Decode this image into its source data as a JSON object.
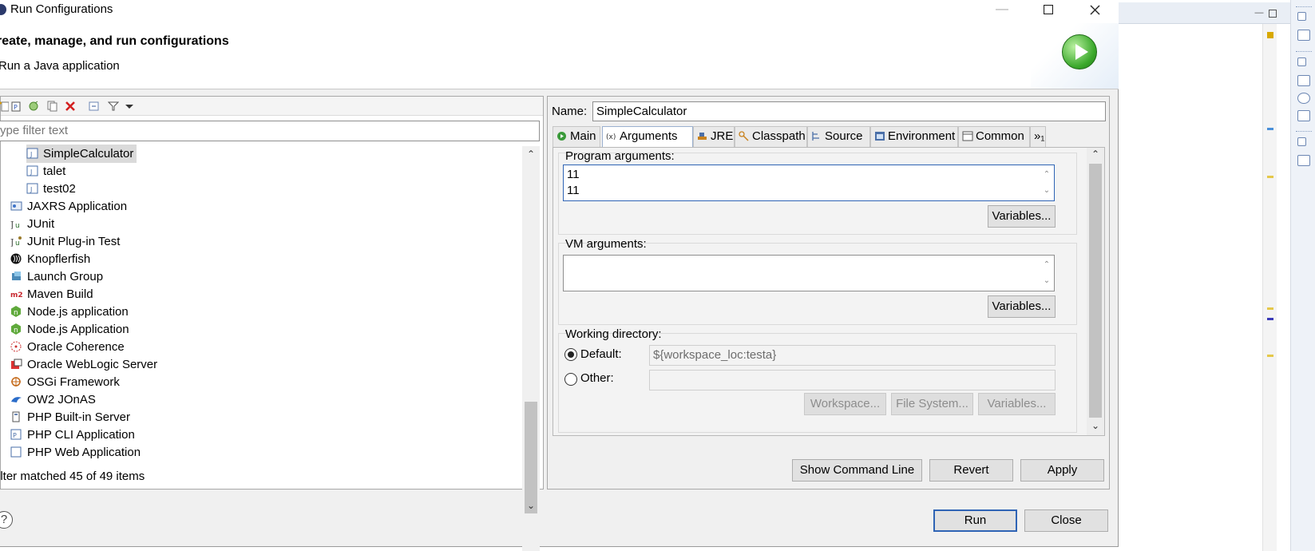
{
  "window": {
    "title": "Run Configurations",
    "minimize_icon": "minimize-icon",
    "maximize_icon": "maximize-icon",
    "close_icon": "close-icon"
  },
  "header": {
    "title": "reate, manage, and run configurations",
    "subtitle": "Run a Java application"
  },
  "left": {
    "filter_placeholder": "ype filter text",
    "status": "ilter matched 45 of 49 items",
    "tree": [
      {
        "label": "SimpleCalculator",
        "icon": "java-app-icon",
        "indent": 1,
        "selected": true
      },
      {
        "label": "talet",
        "icon": "java-app-icon",
        "indent": 1
      },
      {
        "label": "test02",
        "icon": "java-app-icon",
        "indent": 1
      },
      {
        "label": "JAXRS Application",
        "icon": "jaxrs-icon",
        "indent": 0
      },
      {
        "label": "JUnit",
        "icon": "junit-icon",
        "indent": 0
      },
      {
        "label": "JUnit Plug-in Test",
        "icon": "junit-plugin-icon",
        "indent": 0
      },
      {
        "label": "Knopflerfish",
        "icon": "knopflerfish-icon",
        "indent": 0
      },
      {
        "label": "Launch Group",
        "icon": "launch-group-icon",
        "indent": 0
      },
      {
        "label": "Maven Build",
        "icon": "maven-icon",
        "indent": 0
      },
      {
        "label": "Node.js application",
        "icon": "nodejs-icon",
        "indent": 0
      },
      {
        "label": "Node.js Application",
        "icon": "nodejs-icon",
        "indent": 0
      },
      {
        "label": "Oracle Coherence",
        "icon": "oracle-coherence-icon",
        "indent": 0
      },
      {
        "label": "Oracle WebLogic Server",
        "icon": "weblogic-icon",
        "indent": 0
      },
      {
        "label": "OSGi Framework",
        "icon": "osgi-icon",
        "indent": 0
      },
      {
        "label": "OW2 JOnAS",
        "icon": "jonas-icon",
        "indent": 0
      },
      {
        "label": "PHP Built-in Server",
        "icon": "php-server-icon",
        "indent": 0
      },
      {
        "label": "PHP CLI Application",
        "icon": "php-cli-icon",
        "indent": 0
      },
      {
        "label": "PHP Web Application",
        "icon": "php-web-icon",
        "indent": 0
      }
    ]
  },
  "right": {
    "name_label": "Name:",
    "name_value": "SimpleCalculator",
    "tabs": [
      {
        "label": "Main",
        "icon": "main-tab-icon"
      },
      {
        "label": "Arguments",
        "icon": "arguments-tab-icon",
        "active": true
      },
      {
        "label": "JRE",
        "icon": "jre-tab-icon"
      },
      {
        "label": "Classpath",
        "icon": "classpath-tab-icon"
      },
      {
        "label": "Source",
        "icon": "source-tab-icon"
      },
      {
        "label": "Environment",
        "icon": "environment-tab-icon"
      },
      {
        "label": "Common",
        "icon": "common-tab-icon"
      },
      {
        "label": "»₁",
        "icon": ""
      }
    ],
    "program_args_label": "Program arguments:",
    "program_args_lines": [
      "11",
      "11"
    ],
    "vm_args_label": "VM arguments:",
    "variables_label": "Variables...",
    "working_dir_label": "Working directory:",
    "default_label": "Default:",
    "default_value": "${workspace_loc:testa}",
    "other_label": "Other:",
    "workspace_btn": "Workspace...",
    "filesystem_btn": "File System...",
    "show_cmd_btn": "Show Command Line",
    "revert_btn": "Revert",
    "apply_btn": "Apply"
  },
  "footer": {
    "help": "?",
    "run_btn": "Run",
    "close_btn": "Close"
  },
  "colors": {
    "focus_blue": "#2f64b5",
    "run_green": "#3aa82b"
  }
}
